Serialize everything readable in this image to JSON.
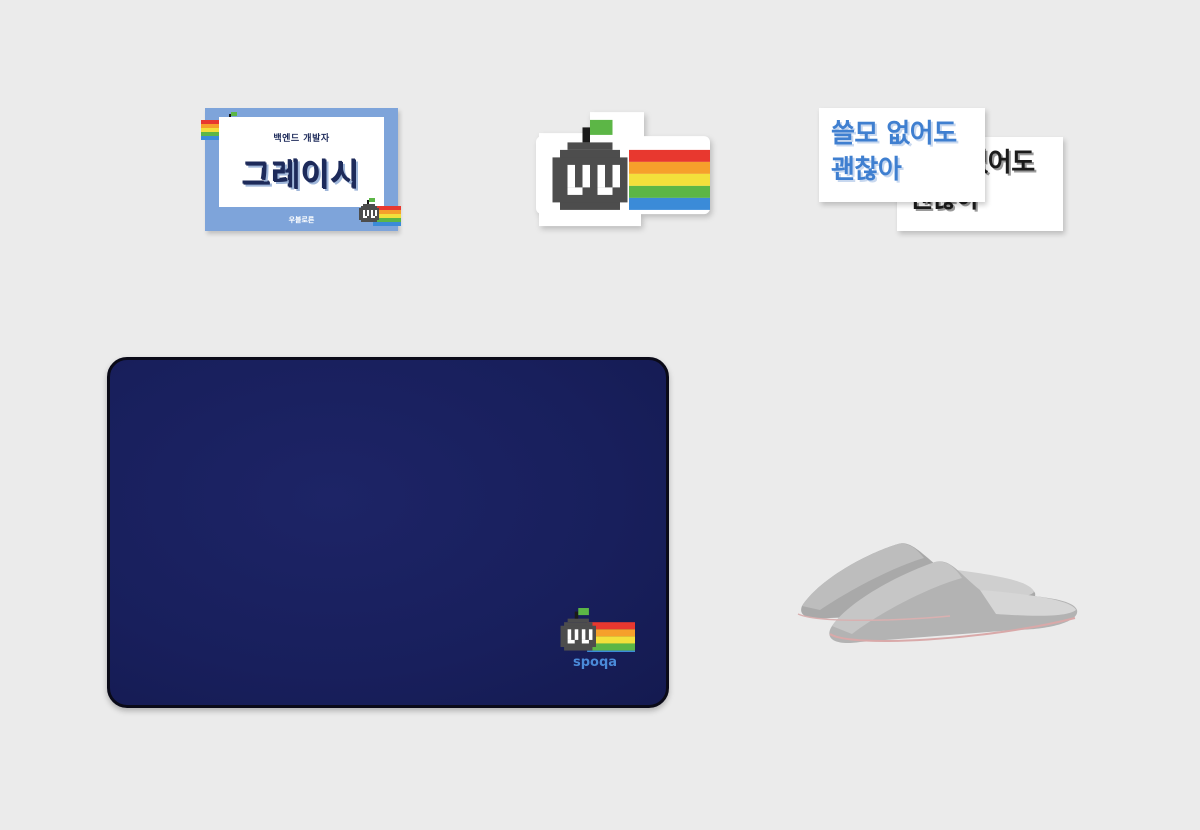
{
  "name_card": {
    "role": "백엔드 개발자",
    "name": "그레이시",
    "brand": "우블로른"
  },
  "text_sticker": {
    "line1": "쓸모 없어도",
    "line2": "괜찮아"
  },
  "mouse_mat": {
    "brand": "spoqa"
  },
  "colors": {
    "background": "#ebebeb",
    "card_blue": "#7ea4da",
    "navy": "#1d2a5a",
    "mat_navy": "#181f5c",
    "sticker_blue": "#3f7fd0",
    "mascot_gray": "#4d4d4d",
    "leaf_green": "#5cb646",
    "slipper_gray": "#b8b8b8"
  },
  "icons": [
    "mascot-rainbow-icon",
    "slippers-image"
  ]
}
